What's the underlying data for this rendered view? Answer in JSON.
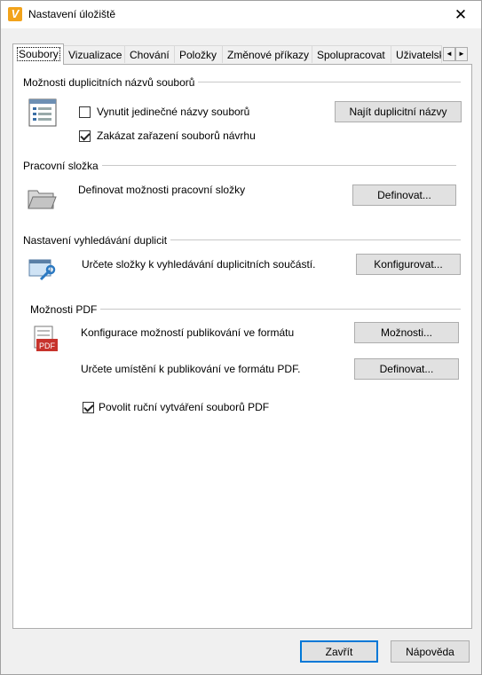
{
  "window": {
    "title": "Nastavení úložiště",
    "app_icon_letter": "V"
  },
  "tabs": [
    {
      "label": "Soubory",
      "active": true
    },
    {
      "label": "Vizualizace"
    },
    {
      "label": "Chování"
    },
    {
      "label": "Položky"
    },
    {
      "label": "Změnové příkazy"
    },
    {
      "label": "Spolupracovat"
    },
    {
      "label": "Uživatelsk"
    }
  ],
  "tab_scroll": {
    "left": "◄",
    "right": "►"
  },
  "groups": {
    "duplicates": {
      "title": "Možnosti duplicitních názvů souborů",
      "unique_names": {
        "label": "Vynutit jedinečné názvy souborů",
        "checked": false
      },
      "disallow_checkin": {
        "label": "Zakázat zařazení souborů návrhu",
        "checked": true
      },
      "find_button": "Najít duplicitní názvy"
    },
    "working_folder": {
      "title": "Pracovní složka",
      "description": "Definovat možnosti pracovní složky",
      "button": "Definovat..."
    },
    "duplicate_search": {
      "title": "Nastavení vyhledávání duplicit",
      "description": "Určete složky k vyhledávání duplicitních součástí.",
      "button": "Konfigurovat..."
    },
    "pdf": {
      "title": "Možnosti PDF",
      "publish_desc": "Konfigurace možností publikování ve formátu",
      "options_button": "Možnosti...",
      "location_desc": "Určete umístění k publikování ve formátu PDF.",
      "define_button": "Definovat...",
      "manual_pdf": {
        "label": "Povolit ruční vytváření souborů PDF",
        "checked": true
      },
      "icon_text": "PDF"
    }
  },
  "footer": {
    "close_button": "Zavřít",
    "help_button": "Nápověda"
  }
}
